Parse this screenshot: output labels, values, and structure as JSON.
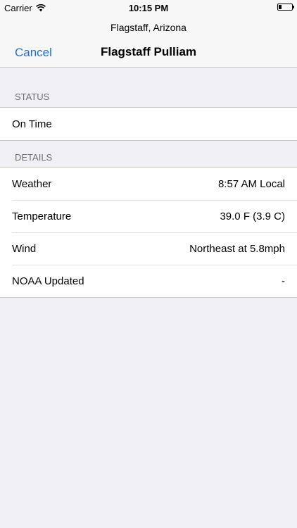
{
  "status_bar": {
    "carrier": "Carrier",
    "time": "10:15 PM",
    "battery_level": 0.2
  },
  "nav": {
    "prompt": "Flagstaff, Arizona",
    "cancel_label": "Cancel",
    "title": "Flagstaff Pulliam",
    "accent_color": "#1b6fd8"
  },
  "status_section": {
    "header": "STATUS",
    "value": "On Time"
  },
  "details_section": {
    "header": "DETAILS",
    "rows": [
      {
        "label": "Weather",
        "value": "8:57 AM Local"
      },
      {
        "label": "Temperature",
        "value": "39.0 F (3.9 C)"
      },
      {
        "label": "Wind",
        "value": "Northeast at 5.8mph"
      },
      {
        "label": "NOAA Updated",
        "value": "-"
      }
    ]
  }
}
